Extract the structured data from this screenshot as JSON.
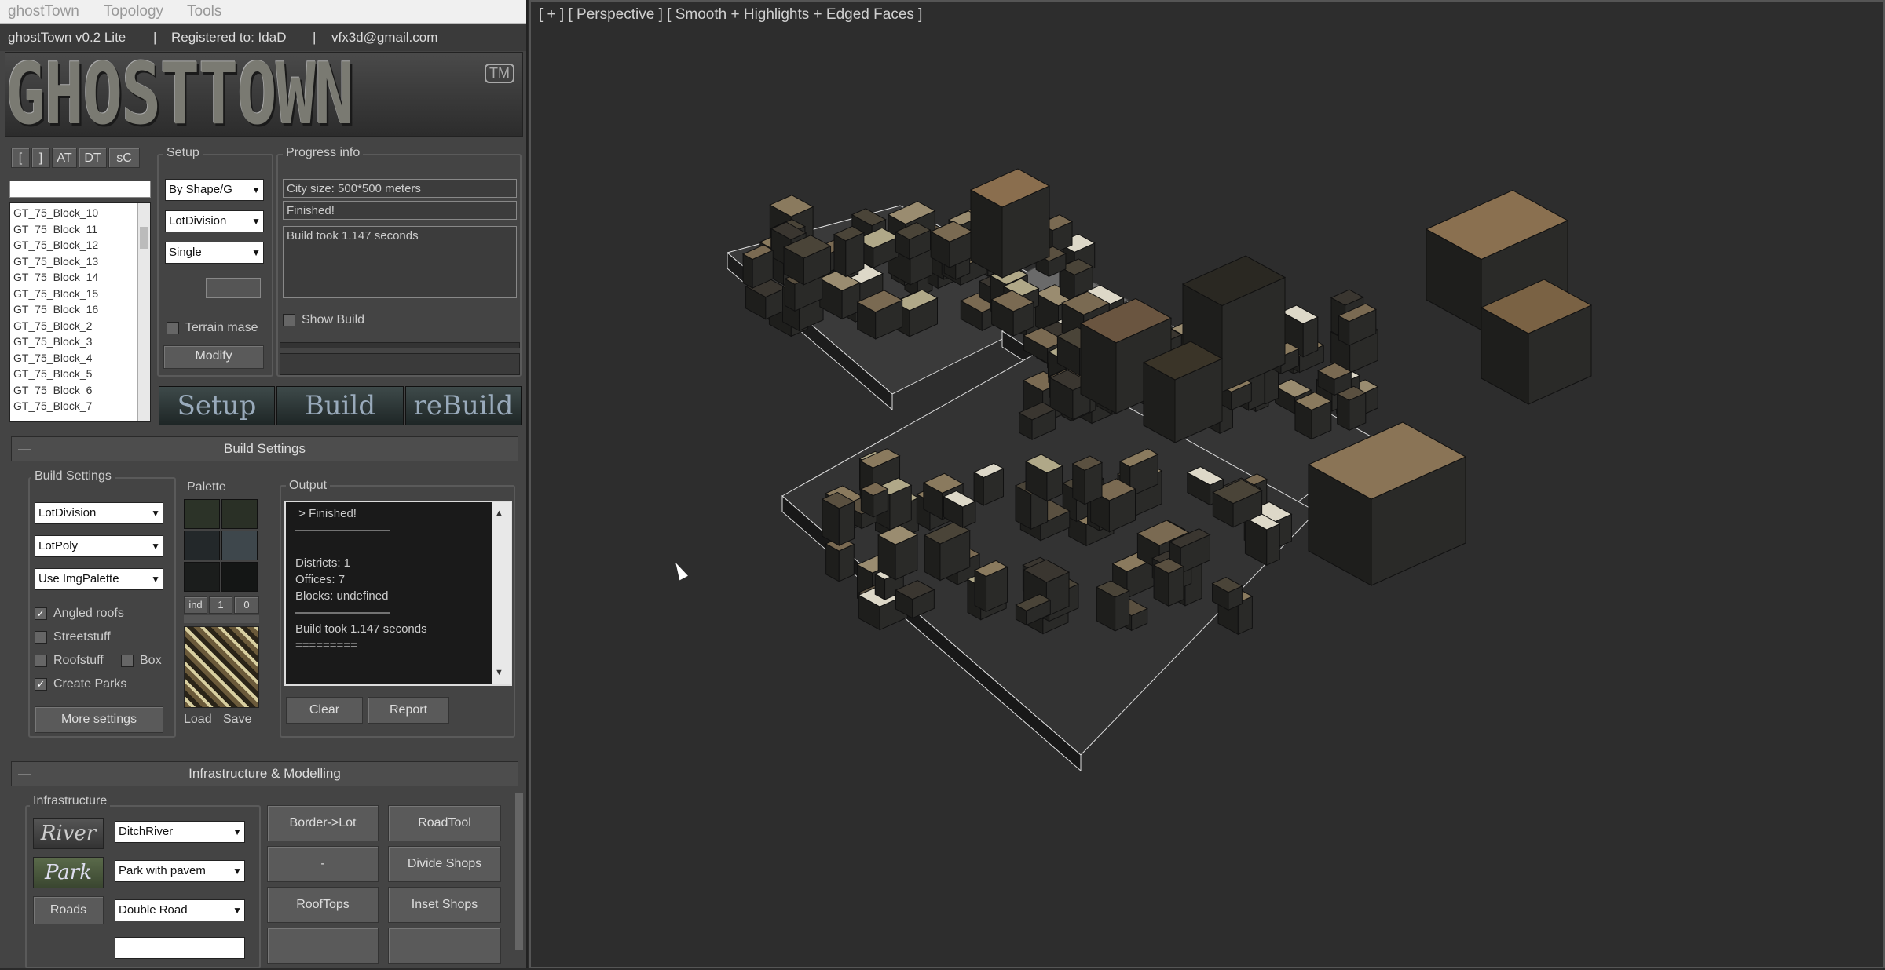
{
  "menubar": {
    "items": [
      "ghostTown",
      "Topology",
      "Tools"
    ]
  },
  "infobar": {
    "version": "ghostTown v0.2 Lite",
    "sep1": "|",
    "registered": "Registered to: IdaD",
    "sep2": "|",
    "email": "vfx3d@gmail.com"
  },
  "logo": {
    "text": "GHOSTTOWN",
    "tm": "TM"
  },
  "tabs": {
    "buttons": [
      "[",
      "]",
      "AT",
      "DT",
      "sC"
    ]
  },
  "blocks": {
    "items": [
      "GT_75_Block_10",
      "GT_75_Block_11",
      "GT_75_Block_12",
      "GT_75_Block_13",
      "GT_75_Block_14",
      "GT_75_Block_15",
      "GT_75_Block_16",
      "GT_75_Block_2",
      "GT_75_Block_3",
      "GT_75_Block_4",
      "GT_75_Block_5",
      "GT_75_Block_6",
      "GT_75_Block_7"
    ]
  },
  "setup": {
    "label": "Setup",
    "dropdowns": [
      "By Shape/G",
      "LotDivision",
      "Single"
    ],
    "terrain_label": "Terrain mase",
    "modify": "Modify"
  },
  "progress": {
    "label": "Progress info",
    "city_size": "City size: 500*500 meters",
    "status": "Finished!",
    "build_time": "Build took 1.147 seconds",
    "show_build": "Show Build"
  },
  "actions": {
    "setup": "Setup",
    "build": "Build",
    "rebuild": "reBuild"
  },
  "build_settings": {
    "rollout": "Build Settings",
    "group_label": "Build Settings",
    "dropdowns": [
      "LotDivision",
      "LotPoly",
      "Use ImgPalette"
    ],
    "checks": [
      {
        "label": "Angled roofs",
        "checked": true
      },
      {
        "label": "Streetstuff",
        "checked": false
      },
      {
        "label": "Roofstuff",
        "checked": false
      },
      {
        "label": "Create Parks",
        "checked": true
      }
    ],
    "box_label": "Box",
    "more_settings": "More settings",
    "palette_label": "Palette",
    "palette_btns": [
      "ind",
      "1",
      "0"
    ],
    "palette_colors": [
      "#2c3328",
      "#2a3026",
      "#23282a",
      "#3e474c",
      "#1b1d1c",
      "#141615"
    ],
    "load": "Load",
    "save": "Save",
    "output_label": "Output",
    "output_lines": [
      " > Finished!",
      "————————",
      "",
      "Districts: 1",
      "Offices: 7",
      "Blocks: undefined",
      "————————",
      "Build took 1.147 seconds",
      "========="
    ],
    "clear": "Clear",
    "report": "Report"
  },
  "infra": {
    "rollout": "Infrastructure & Modelling",
    "group_label": "Infrastructure",
    "river_icon": "River",
    "park_icon": "Park",
    "roads_btn": "Roads",
    "dropdowns": [
      "DitchRiver",
      "Park with pavem",
      "Double Road"
    ],
    "mid_buttons": [
      "Border->Lot",
      "-",
      "RoofTops"
    ],
    "right_buttons": [
      "RoadTool",
      "Divide Shops",
      "Inset Shops"
    ]
  },
  "viewport": {
    "label": "[ + ] [ Perspective ] [ Smooth + Highlights + Edged Faces ]"
  }
}
